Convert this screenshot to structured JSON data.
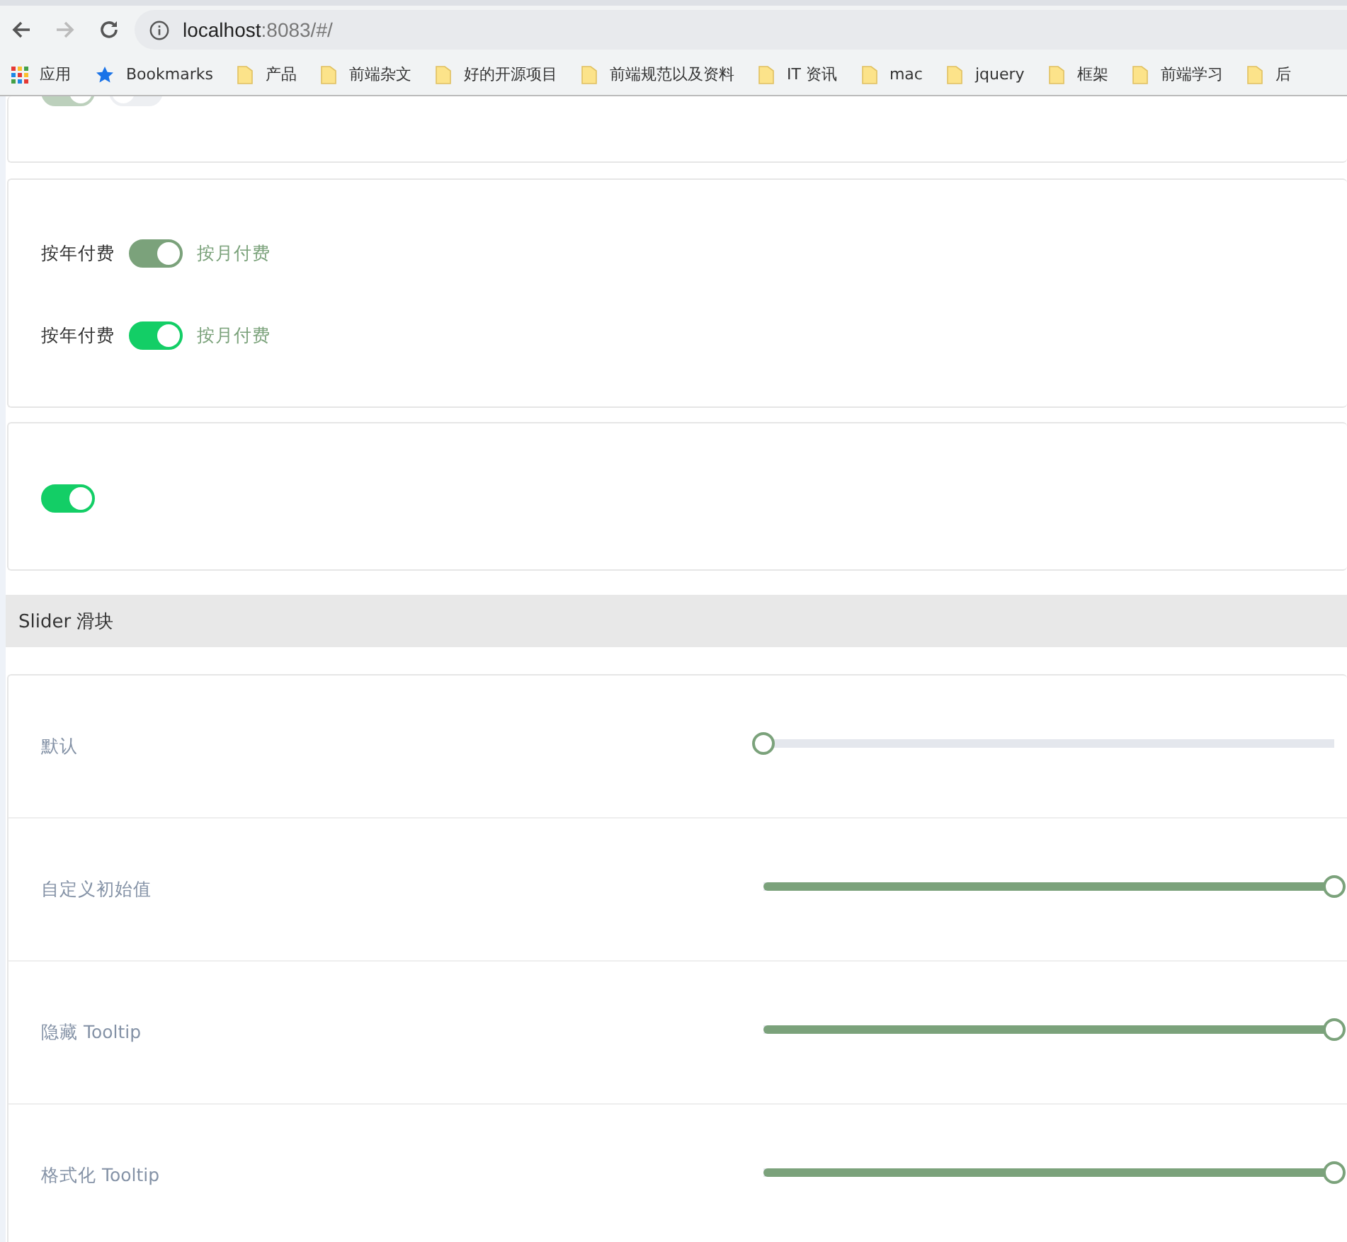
{
  "browser": {
    "url_host": "localhost",
    "url_rest": ":8083/#/",
    "back_disabled": false,
    "forward_disabled": true
  },
  "bookmarks": [
    {
      "kind": "apps",
      "label": "应用"
    },
    {
      "kind": "star",
      "label": "Bookmarks"
    },
    {
      "kind": "folder",
      "label": "产品"
    },
    {
      "kind": "folder",
      "label": "前端杂文"
    },
    {
      "kind": "folder",
      "label": "好的开源项目"
    },
    {
      "kind": "folder",
      "label": "前端规范以及资料"
    },
    {
      "kind": "folder",
      "label": "IT 资讯"
    },
    {
      "kind": "folder",
      "label": "mac"
    },
    {
      "kind": "folder",
      "label": "jquery"
    },
    {
      "kind": "folder",
      "label": "框架"
    },
    {
      "kind": "folder",
      "label": "前端学习"
    },
    {
      "kind": "folder",
      "label": "后"
    }
  ],
  "top_card": {
    "switches": [
      {
        "on": true,
        "disabled": true
      },
      {
        "on": false,
        "disabled": true
      }
    ]
  },
  "text_switches": [
    {
      "inactive_text": "按年付费",
      "active_text": "按月付费",
      "on": true,
      "color": "#7ba27b"
    },
    {
      "inactive_text": "按年付费",
      "active_text": "按月付费",
      "on": true,
      "color": "#13ce66"
    }
  ],
  "plain_switch": {
    "on": true,
    "color": "#13ce66"
  },
  "section_title": "Slider 滑块",
  "sliders": [
    {
      "label": "默认",
      "level": 0
    },
    {
      "label": "自定义初始值",
      "level": 1
    },
    {
      "label": "隐藏 Tooltip",
      "level": 1
    },
    {
      "label": "格式化 Tooltip",
      "level": 1
    }
  ]
}
